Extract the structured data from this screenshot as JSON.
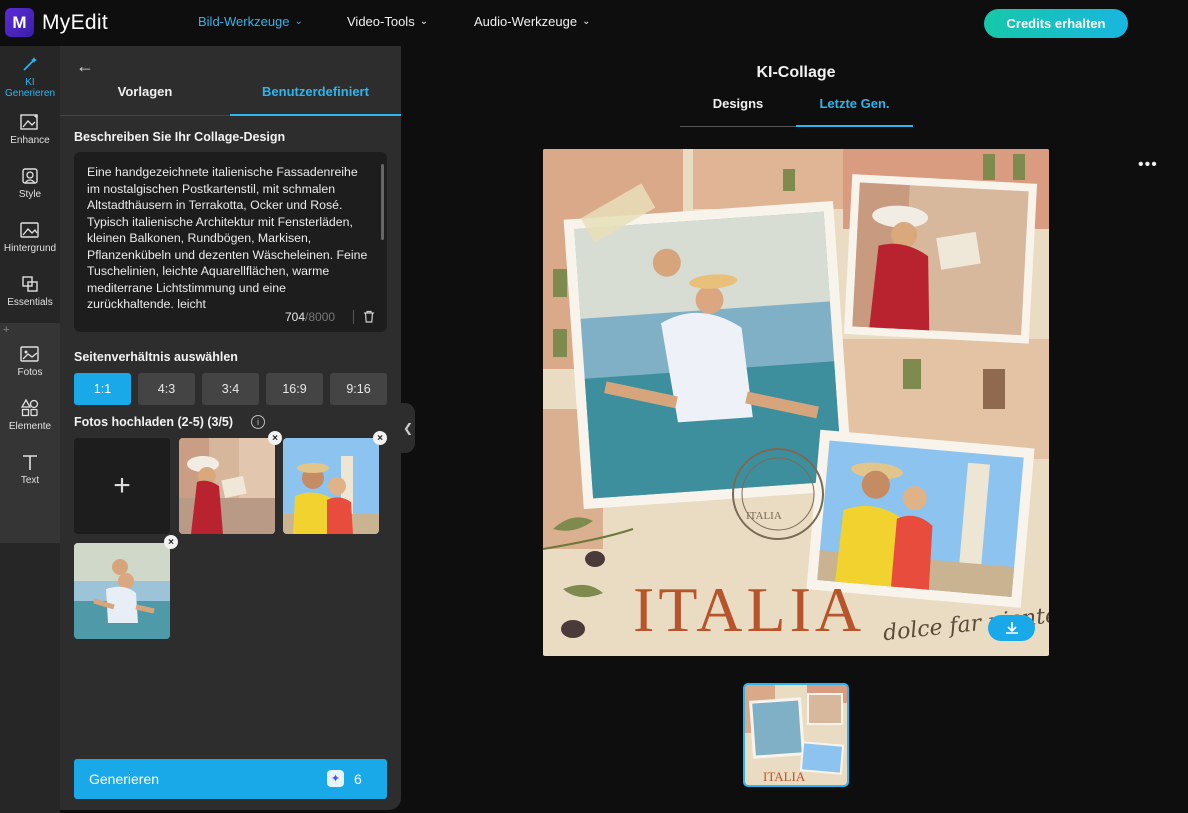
{
  "app": {
    "name": "MyEdit",
    "logo_letter": "M"
  },
  "topnav": {
    "items": [
      {
        "label": "Bild-Werkzeuge",
        "active": true
      },
      {
        "label": "Video-Tools",
        "active": false
      },
      {
        "label": "Audio-Werkzeuge",
        "active": false
      }
    ],
    "credits_button": "Credits erhalten"
  },
  "rail": {
    "items": [
      {
        "label": "KI Generieren",
        "icon": "magic-wand-icon",
        "active": true
      },
      {
        "label": "Enhance",
        "icon": "enhance-icon"
      },
      {
        "label": "Style",
        "icon": "style-icon"
      },
      {
        "label": "Hintergrund",
        "icon": "background-icon"
      },
      {
        "label": "Essentials",
        "icon": "essentials-icon"
      },
      {
        "label": "Fotos",
        "icon": "photos-icon"
      },
      {
        "label": "Elemente",
        "icon": "elements-icon"
      },
      {
        "label": "Text",
        "icon": "text-icon"
      }
    ],
    "plus": "+"
  },
  "panel": {
    "tabs": [
      {
        "label": "Vorlagen",
        "active": false
      },
      {
        "label": "Benutzerdefiniert",
        "active": true
      }
    ],
    "prompt_title": "Beschreiben Sie Ihr Collage-Design",
    "prompt_text": "Eine handgezeichnete italienische Fassadenreihe im nostalgischen Postkartenstil, mit schmalen Altstadthäusern in Terrakotta, Ocker und Rosé. Typisch italienische Architektur mit Fensterläden, kleinen Balkonen, Rundbögen, Markisen, Pflanzenkübeln und dezenten Wäscheleinen. Feine Tuschelinien, leichte Aquarellflächen, warme mediterrane Lichtstimmung und eine zurückhaltende, leicht",
    "char_count": "704",
    "char_max": "/8000",
    "ratio_title": "Seitenverhältnis auswählen",
    "ratios": [
      {
        "label": "1:1",
        "selected": true
      },
      {
        "label": "4:3",
        "selected": false
      },
      {
        "label": "3:4",
        "selected": false
      },
      {
        "label": "16:9",
        "selected": false
      },
      {
        "label": "9:16",
        "selected": false
      }
    ],
    "upload_title": "Fotos hochladen (2-5) (3/5)",
    "upload_plus": "+",
    "generate_label": "Generieren",
    "generate_cost": "6"
  },
  "main": {
    "title": "KI-Collage",
    "tabs": [
      {
        "label": "Designs",
        "active": false
      },
      {
        "label": "Letzte Gen.",
        "active": true
      }
    ],
    "more": "•••",
    "collage": {
      "main_text": "ITALIA",
      "script_text": "dolce far niente",
      "stamp_text": "ITALIA"
    },
    "thumb_text": "ITALIA"
  },
  "colors": {
    "accent": "#19a8e8",
    "brand": "#5b2bd8"
  }
}
